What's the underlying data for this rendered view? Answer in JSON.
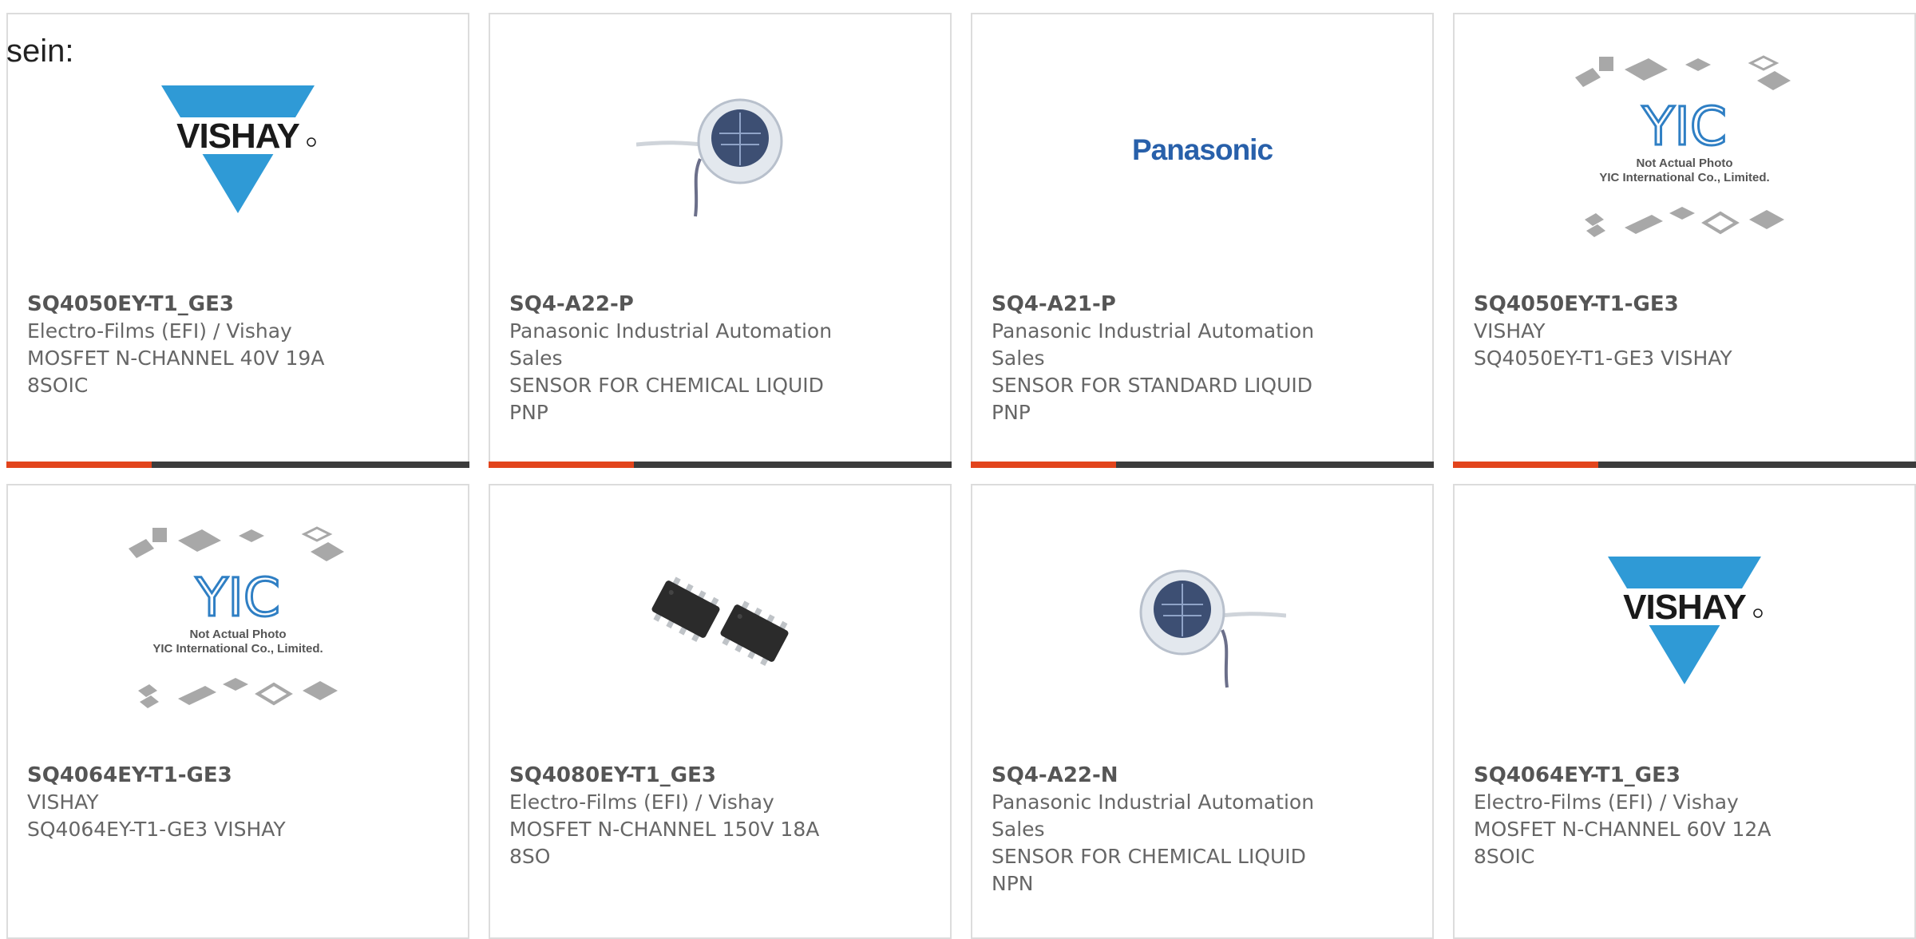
{
  "intro_text": "sein:",
  "colors": {
    "accent": "#e2441c",
    "bar": "#3c3c3c",
    "vishay_blue": "#2f9ad6",
    "panasonic_blue": "#2860aa"
  },
  "products": [
    {
      "part_number": "SQ4050EY-T1_GE3",
      "manufacturer": "Electro-Films (EFI) / Vishay",
      "description": "MOSFET N-CHANNEL 40V 19A\n8SOIC",
      "image": "vishay-logo"
    },
    {
      "part_number": "SQ4-A22-P",
      "manufacturer": "Panasonic Industrial Automation\nSales",
      "description": "SENSOR FOR CHEMICAL LIQUID\nPNP",
      "image": "liquid-sensor-photo"
    },
    {
      "part_number": "SQ4-A21-P",
      "manufacturer": "Panasonic Industrial Automation\nSales",
      "description": "SENSOR FOR STANDARD LIQUID\nPNP",
      "image": "panasonic-logo"
    },
    {
      "part_number": "SQ4050EY-T1-GE3",
      "manufacturer": "VISHAY",
      "description": "SQ4050EY-T1-GE3 VISHAY",
      "image": "yic-placeholder"
    },
    {
      "part_number": "SQ4064EY-T1-GE3",
      "manufacturer": "VISHAY",
      "description": "SQ4064EY-T1-GE3 VISHAY",
      "image": "yic-placeholder"
    },
    {
      "part_number": "SQ4080EY-T1_GE3",
      "manufacturer": "Electro-Films (EFI) / Vishay",
      "description": "MOSFET N-CHANNEL 150V 18A\n8SO",
      "image": "soic8-chips-photo"
    },
    {
      "part_number": "SQ4-A22-N",
      "manufacturer": "Panasonic Industrial Automation\nSales",
      "description": "SENSOR FOR CHEMICAL LIQUID\nNPN",
      "image": "liquid-sensor-photo"
    },
    {
      "part_number": "SQ4064EY-T1_GE3",
      "manufacturer": "Electro-Films (EFI) / Vishay",
      "description": "MOSFET N-CHANNEL 60V 12A\n8SOIC",
      "image": "vishay-logo"
    }
  ],
  "logos": {
    "vishay": "VISHAY",
    "panasonic": "Panasonic",
    "yic_caption_1": "Not Actual Photo",
    "yic_caption_2": "YIC International Co., Limited."
  }
}
